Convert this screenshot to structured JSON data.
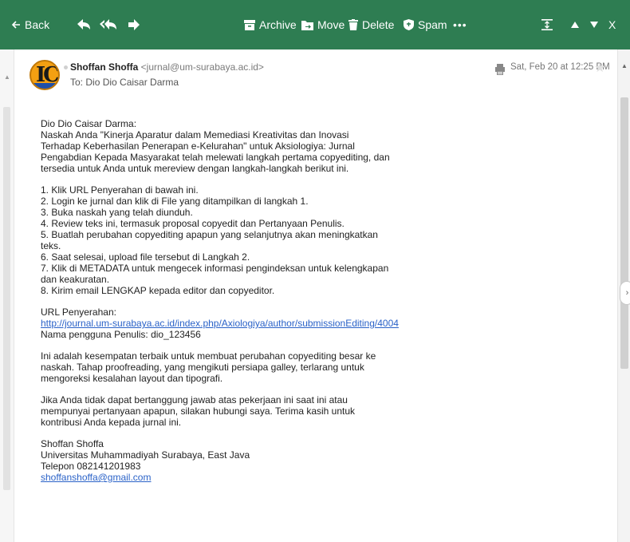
{
  "toolbar": {
    "back_label": "Back",
    "archive_label": "Archive",
    "move_label": "Move",
    "delete_label": "Delete",
    "spam_label": "Spam",
    "more_label": "•••",
    "close_label": "X"
  },
  "colors": {
    "toolbar_bg": "#2e7d52",
    "link": "#2a62c8"
  },
  "message": {
    "sender_name": "Shoffan Shoffa",
    "sender_email": "<jurnal@um-surabaya.ac.id>",
    "to_label": "To:",
    "to_name": "Dio Dio Caisar Darma",
    "date": "Sat, Feb 20 at 12:25 PM"
  },
  "body": {
    "greeting": "Dio Dio Caisar Darma:",
    "intro": [
      "Naskah Anda \"Kinerja Aparatur dalam Memediasi Kreativitas dan Inovasi",
      "Terhadap Keberhasilan Penerapan e-Kelurahan\" untuk Aksiologiya: Jurnal",
      "Pengabdian Kepada Masyarakat telah melewati langkah pertama copyediting, dan",
      "tersedia untuk Anda untuk mereview dengan langkah-langkah berikut ini."
    ],
    "steps": [
      "1. Klik URL Penyerahan di bawah ini.",
      "2. Login ke jurnal dan klik di File yang ditampilkan di langkah 1.",
      "3. Buka naskah yang telah diunduh.",
      "4. Review teks ini, termasuk proposal copyedit dan Pertanyaan Penulis.",
      "5. Buatlah perubahan copyediting apapun yang selanjutnya akan meningkatkan",
      "teks.",
      "6. Saat selesai, upload file tersebut di Langkah 2.",
      "7. Klik di METADATA untuk mengecek informasi pengindeksan untuk kelengkapan",
      "dan keakuratan.",
      "8. Kirim email LENGKAP kepada editor dan copyeditor."
    ],
    "url_label": "URL Penyerahan:",
    "url": "http://journal.um-surabaya.ac.id/index.php/Axiologiya/author/submissionEditing/4004",
    "username": "Nama pengguna Penulis: dio_123456",
    "opportunity": [
      "Ini adalah kesempatan terbaik untuk membuat perubahan copyediting besar ke",
      "naskah. Tahap proofreading, yang mengikuti persiapa galley, terlarang untuk",
      "mengoreksi kesalahan layout dan tipografi."
    ],
    "closing": [
      "Jika Anda tidak dapat bertanggung jawab atas pekerjaan ini saat ini atau",
      "mempunyai pertanyaan apapun, silakan hubungi saya. Terima kasih untuk",
      "kontribusi Anda kepada jurnal ini."
    ],
    "signature": [
      "Shoffan Shoffa",
      "Universitas Muhammadiyah Surabaya, East Java",
      "Telepon 082141201983",
      "shoffanshoffa@gmail.com"
    ]
  }
}
